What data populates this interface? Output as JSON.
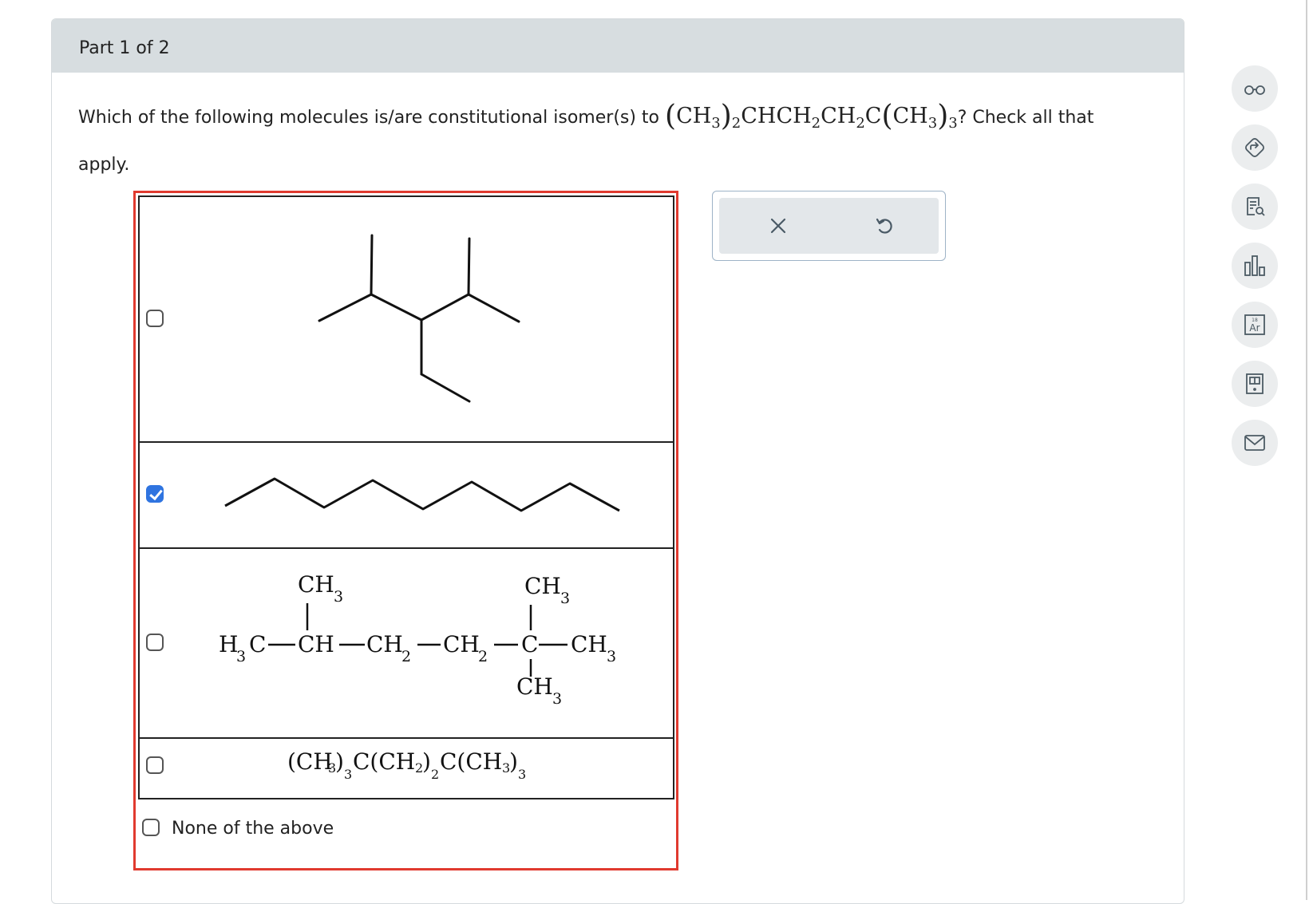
{
  "part_label": "Part 1 of 2",
  "question": {
    "prefix": "Which of the following molecules is/are constitutional isomer(s) to",
    "formula": {
      "a": "CH",
      "a_sub": "3",
      "a_count": "2",
      "mid": "CHCH",
      "mid_sub1": "2",
      "mid2": "CH",
      "mid_sub2": "2",
      "mid3": "C",
      "b": "CH",
      "b_sub": "3",
      "b_count": "3"
    },
    "suffix_line1": "? Check all that",
    "suffix_line2": "apply."
  },
  "choices": [
    {
      "checked": false,
      "kind": "skeletal-branched"
    },
    {
      "checked": true,
      "kind": "skeletal-chain"
    },
    {
      "checked": false,
      "kind": "condensed",
      "labels": {
        "ch3_top_left": "CH",
        "ch3_top_right": "CH",
        "h3c": "H",
        "c": "C",
        "ch": "CH",
        "ch2a": "CH",
        "ch2b": "CH",
        "cq": "C",
        "ch3_right": "CH",
        "ch3_bottom": "CH",
        "sub3": "3",
        "sub2": "2"
      }
    },
    {
      "checked": false,
      "kind": "formula",
      "text": {
        "p1": "(CH",
        "s1": "3",
        "p2": ")",
        "c1": "3",
        "p3": "C(CH",
        "s2": "2",
        "p4": ")",
        "c2": "2",
        "p5": "C(CH",
        "s3": "3",
        "p6": ")",
        "c3": "3"
      }
    }
  ],
  "none_of_the_above": "None of the above",
  "toolbar": {
    "clear_icon": "x-icon",
    "undo_icon": "undo-icon"
  },
  "side_icons": [
    "glasses-icon",
    "arrow-diamond-icon",
    "notes-icon",
    "bar-chart-icon",
    "periodic-table-icon",
    "calculator-icon",
    "mail-icon"
  ],
  "periodic_table": {
    "number": "18",
    "symbol": "Ar"
  },
  "colors": {
    "header": "#d7dde0",
    "selection_border": "#e03a2f",
    "checkbox_checked": "#2f74e0"
  }
}
